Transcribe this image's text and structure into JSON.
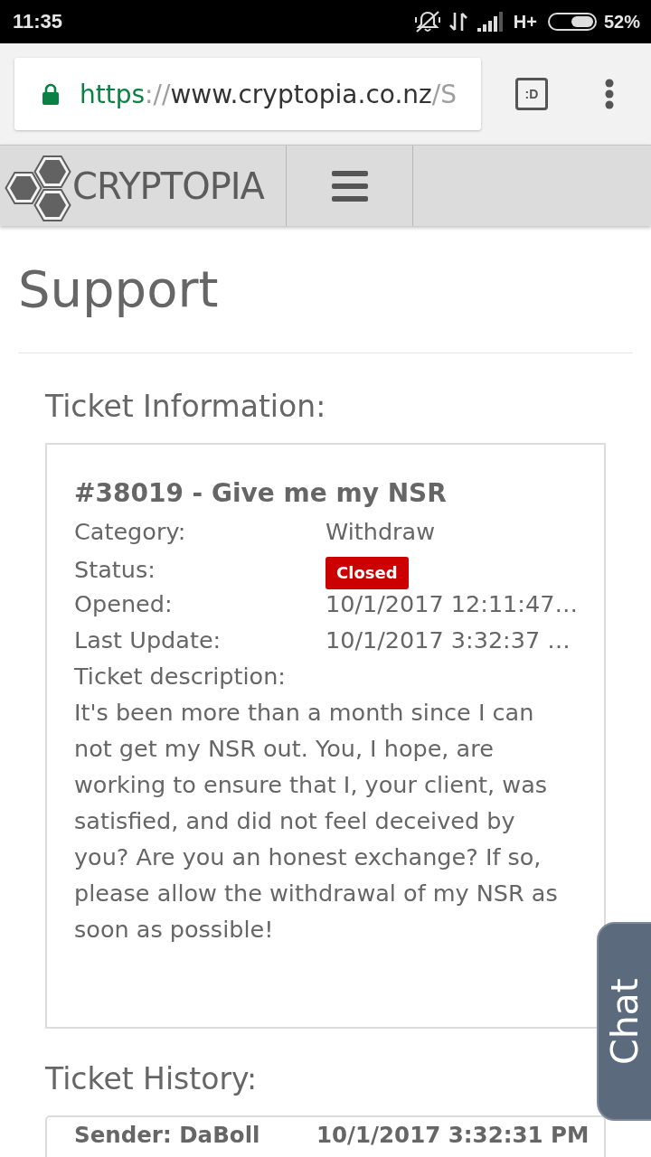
{
  "status_bar": {
    "time": "11:35",
    "network_type": "H+",
    "battery": "52%"
  },
  "browser": {
    "url": {
      "scheme": "https",
      "separator": "://",
      "host": "www.cryptopia.co.nz",
      "path": "/S"
    },
    "tab_count": ":D"
  },
  "site_header": {
    "logo_text": "CRYPTOPIA"
  },
  "page_title": "Support",
  "ticket_information": {
    "heading": "Ticket Information:",
    "title": "#38019 - Give me my NSR",
    "fields": [
      {
        "kind": "text",
        "label": "Category:",
        "value": "Withdraw"
      },
      {
        "kind": "badge",
        "label": "Status:",
        "value": "Closed"
      },
      {
        "kind": "text",
        "label": "Opened:",
        "value": "10/1/2017 12:11:47…"
      },
      {
        "kind": "text",
        "label": "Last Update:",
        "value": "10/1/2017 3:32:37 …"
      }
    ],
    "description_label": "Ticket description:",
    "description": "It's been more than a month since I can not get my NSR out. You, I hope, are working to ensure that I, your client, was satisfied, and did not feel deceived by you? Are you an honest exchange? If so, please allow the withdrawal of my NSR as soon as possible!"
  },
  "ticket_history": {
    "heading": "Ticket History:",
    "entries": [
      {
        "sender": "Sender: DaBoll",
        "time": "10/1/2017 3:32:31 PM"
      }
    ]
  },
  "chat_tab": {
    "label": "Chat"
  }
}
